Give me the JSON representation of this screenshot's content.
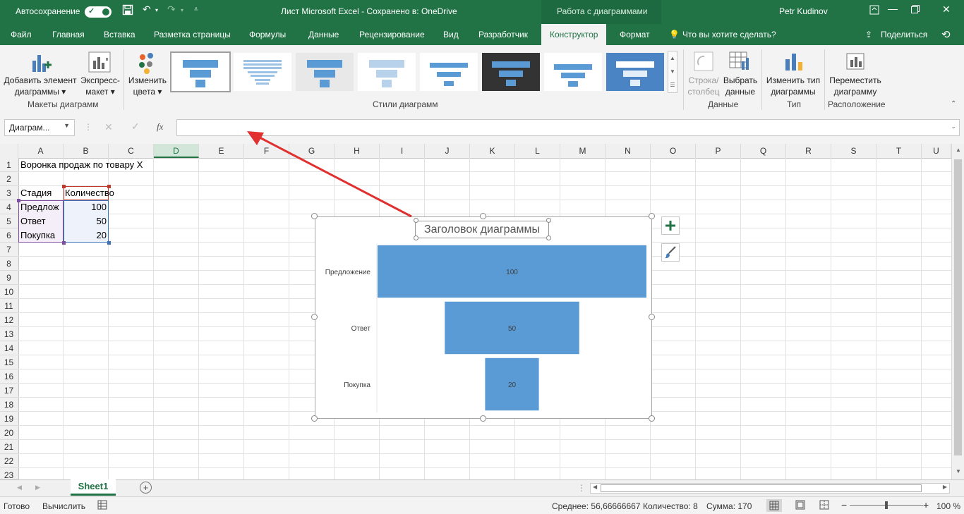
{
  "titlebar": {
    "autosave_label": "Автосохранение",
    "file_title": "Лист Microsoft Excel  -  Сохранено в: OneDrive",
    "context_label": "Работа с диаграммами",
    "user": "Petr Kudinov"
  },
  "tabs": [
    "Файл",
    "Главная",
    "Вставка",
    "Разметка страницы",
    "Формулы",
    "Данные",
    "Рецензирование",
    "Вид",
    "Разработчик",
    "Конструктор",
    "Формат"
  ],
  "active_tab": "Конструктор",
  "tellme": "Что вы хотите сделать?",
  "share": "Поделиться",
  "ribbon": {
    "add_element": [
      "Добавить элемент",
      "диаграммы"
    ],
    "quick_layout": [
      "Экспресс-",
      "макет"
    ],
    "change_colors": [
      "Изменить",
      "цвета"
    ],
    "switch_row_col": [
      "Строка/",
      "столбец"
    ],
    "select_data": [
      "Выбрать",
      "данные"
    ],
    "change_type": [
      "Изменить тип",
      "диаграммы"
    ],
    "move_chart": [
      "Переместить",
      "диаграмму"
    ],
    "groups": {
      "layouts": "Макеты диаграмм",
      "styles": "Стили диаграмм",
      "data": "Данные",
      "type": "Тип",
      "location": "Расположение"
    }
  },
  "namebox": "Диаграм...",
  "fx": "fx",
  "columns": [
    "A",
    "B",
    "C",
    "D",
    "E",
    "F",
    "G",
    "H",
    "I",
    "J",
    "K",
    "L",
    "M",
    "N",
    "O",
    "P",
    "Q",
    "R",
    "S",
    "T",
    "U"
  ],
  "rows": [
    "1",
    "2",
    "3",
    "4",
    "5",
    "6",
    "7",
    "8",
    "9",
    "10",
    "11",
    "12",
    "13",
    "14",
    "15",
    "16",
    "17",
    "18",
    "19",
    "20",
    "21",
    "22",
    "23"
  ],
  "cells": {
    "a1": "Воронка продаж по товару X",
    "a3": "Стадия",
    "b3": "Количество",
    "a4": "Предлож",
    "b4": "100",
    "a5": "Ответ",
    "b5": "50",
    "a6": "Покупка",
    "b6": "20"
  },
  "chart_data": {
    "type": "bar",
    "subtype": "funnel",
    "title": "Заголовок диаграммы",
    "categories": [
      "Предложение",
      "Ответ",
      "Покупка"
    ],
    "values": [
      100,
      50,
      20
    ],
    "data_labels": [
      "100",
      "50",
      "20"
    ],
    "color": "#5b9bd5",
    "legend": "none",
    "grid": false
  },
  "sheet_tab": "Sheet1",
  "status": {
    "ready": "Готово",
    "calc": "Вычислить",
    "avg": "Среднее: 56,66666667",
    "count": "Количество: 8",
    "sum": "Сумма: 170",
    "zoom": "100 %"
  },
  "colors": {
    "excel_green": "#217346",
    "chart_blue": "#5b9bd5",
    "annotation_arrow": "#e03030"
  }
}
